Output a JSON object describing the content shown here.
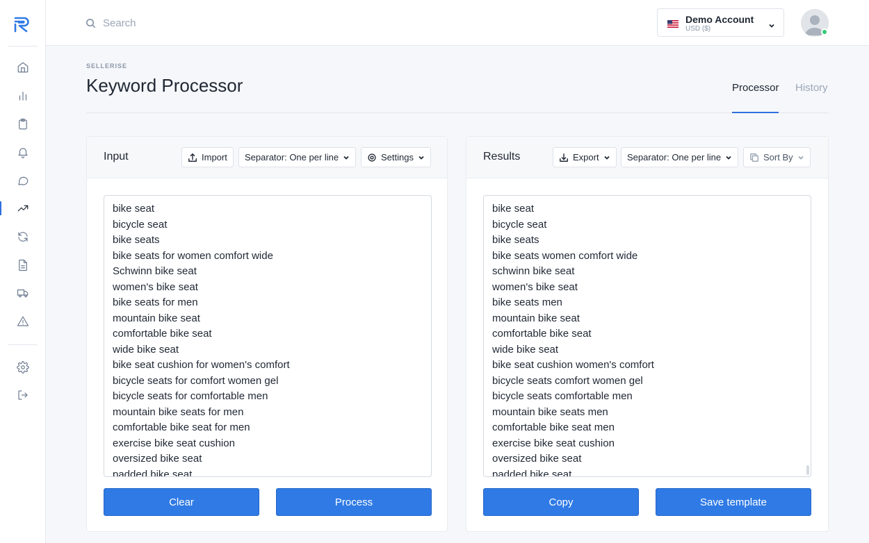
{
  "search": {
    "placeholder": "Search"
  },
  "account": {
    "name": "Demo Account",
    "currency": "USD ($)"
  },
  "header": {
    "eyebrow": "SELLERISE",
    "title": "Keyword Processor"
  },
  "tabs": [
    {
      "label": "Processor",
      "active": true
    },
    {
      "label": "History",
      "active": false
    }
  ],
  "input_panel": {
    "title": "Input",
    "import_label": "Import",
    "separator_label": "Separator: One per line",
    "settings_label": "Settings",
    "keywords": [
      "bike seat",
      "bicycle seat",
      "bike seats",
      "bike seats for women comfort wide",
      "Schwinn bike seat",
      "women's bike seat",
      "bike seats for men",
      "mountain bike seat",
      "comfortable bike seat",
      "wide bike seat",
      "bike seat cushion for women's comfort",
      "bicycle seats for comfort women gel",
      "bicycle seats for comfortable men",
      "mountain bike seats for men",
      "comfortable bike seat for men",
      "exercise bike seat cushion",
      "oversized bike seat",
      "padded bike seat"
    ],
    "clear_label": "Clear",
    "process_label": "Process"
  },
  "results_panel": {
    "title": "Results",
    "export_label": "Export",
    "separator_label": "Separator: One per line",
    "sort_label": "Sort By",
    "keywords": [
      "bike seat",
      "bicycle seat",
      "bike seats",
      "bike seats women comfort wide",
      "schwinn bike seat",
      "women's bike seat",
      "bike seats men",
      "mountain bike seat",
      "comfortable bike seat",
      "wide bike seat",
      "bike seat cushion women's comfort",
      "bicycle seats comfort women gel",
      "bicycle seats comfortable men",
      "mountain bike seats men",
      "comfortable bike seat men",
      "exercise bike seat cushion",
      "oversized bike seat",
      "padded bike seat"
    ],
    "copy_label": "Copy",
    "save_label": "Save template"
  },
  "colors": {
    "accent": "#2f7ae5",
    "online": "#2ecc71"
  },
  "icons": {
    "sidebar": [
      "home-icon",
      "bar-chart-icon",
      "clipboard-icon",
      "bell-icon",
      "chat-icon",
      "trending-icon",
      "refresh-icon",
      "document-icon",
      "truck-icon",
      "alert-icon",
      "gear-icon",
      "logout-icon"
    ]
  }
}
